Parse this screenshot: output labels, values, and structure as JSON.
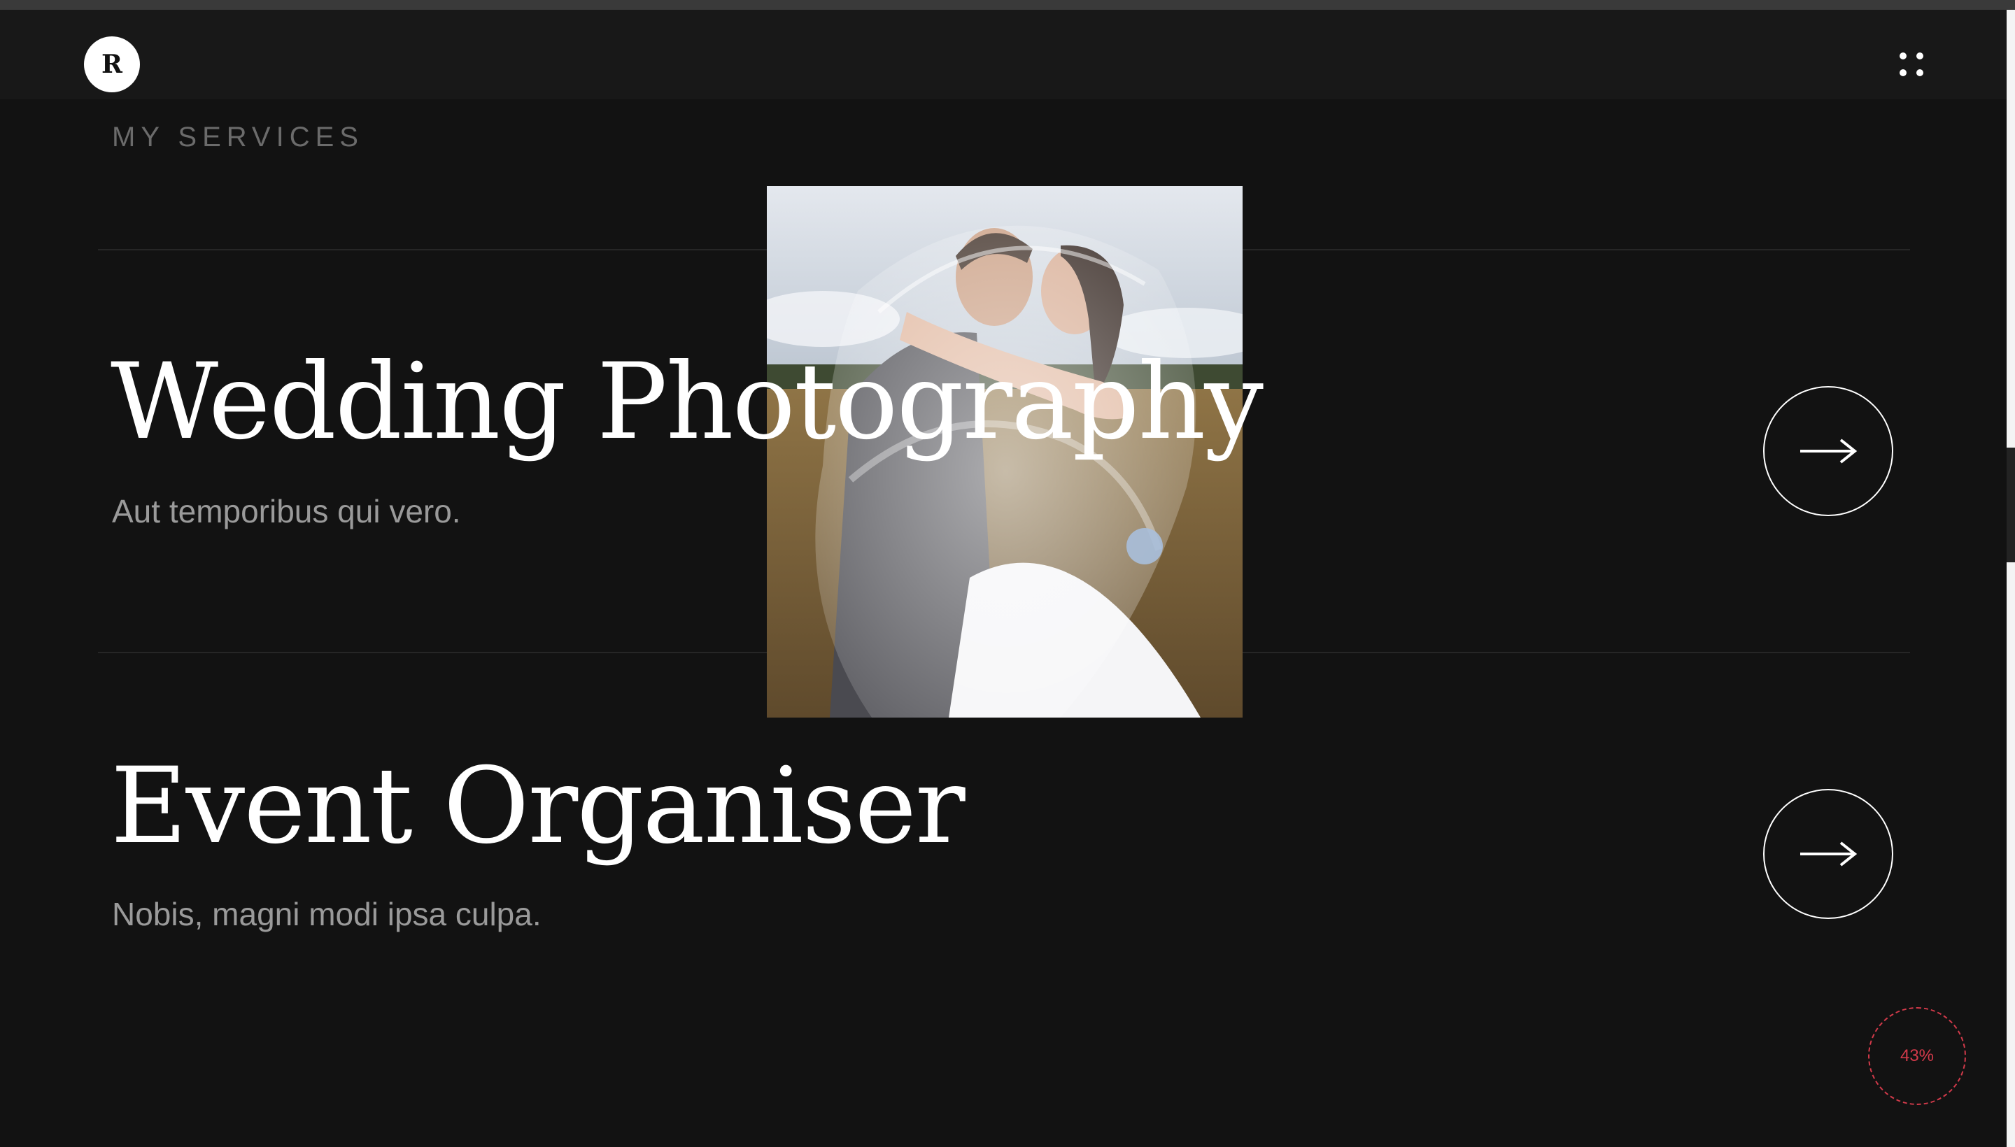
{
  "header": {
    "logo_letter": "R",
    "menu_icon": "dots-grid-icon"
  },
  "section": {
    "label": "MY SERVICES"
  },
  "services": [
    {
      "title": "Wedding Photography",
      "subtitle": "Aut temporibus qui vero.",
      "action_icon": "arrow-right-icon"
    },
    {
      "title": "Event Organiser",
      "subtitle": "Nobis, magni modi ipsa culpa.",
      "action_icon": "arrow-right-icon"
    }
  ],
  "scroll_progress": {
    "value": 0.43,
    "label": "43%"
  },
  "colors": {
    "background": "#121212",
    "header": "#181818",
    "accent": "#d23a4a",
    "text": "#ffffff",
    "muted": "#9a9a9a"
  }
}
